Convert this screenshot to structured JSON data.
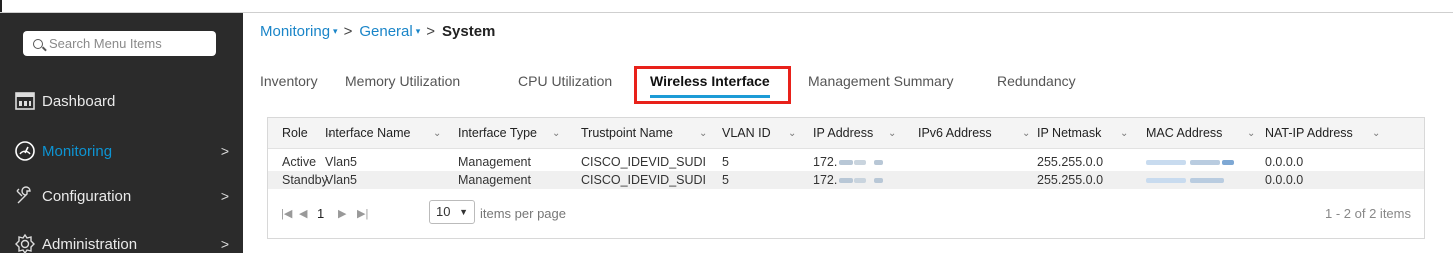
{
  "sidebar": {
    "search": {
      "placeholder": "Search Menu Items"
    },
    "items": [
      {
        "label": "Dashboard",
        "icon": "dashboard-icon"
      },
      {
        "label": "Monitoring",
        "icon": "gauge-icon",
        "chevron": ">"
      },
      {
        "label": "Configuration",
        "icon": "wrench-icon",
        "chevron": ">"
      },
      {
        "label": "Administration",
        "icon": "gear-icon",
        "chevron": ">"
      }
    ],
    "colors": {
      "background": "#2b2b2b",
      "active": "#0d94d3"
    }
  },
  "breadcrumb": {
    "items": [
      "Monitoring",
      "General",
      "System"
    ],
    "caret": "▾",
    "separator": ">"
  },
  "tabs": [
    "Inventory",
    "Memory Utilization",
    "CPU Utilization",
    "Wireless Interface",
    "Management Summary",
    "Redundancy"
  ],
  "active_tab": "Wireless Interface",
  "highlight_color": "#e8211a",
  "table": {
    "columns": [
      "Role",
      "Interface Name",
      "Interface Type",
      "Trustpoint Name",
      "VLAN ID",
      "IP Address",
      "IPv6 Address",
      "IP Netmask",
      "MAC Address",
      "NAT-IP Address"
    ],
    "rows": [
      [
        "Active",
        "Vlan5",
        "Management",
        "CISCO_IDEVID_SUDI",
        "5",
        "172.",
        "",
        "255.255.0.0",
        "",
        "0.0.0.0"
      ],
      [
        "Standby",
        "Vlan5",
        "Management",
        "CISCO_IDEVID_SUDI",
        "5",
        "172.",
        "",
        "255.255.0.0",
        "",
        "0.0.0.0"
      ]
    ],
    "sort_caret": "⌄"
  },
  "pager": {
    "first": "|◀",
    "prev": "◀",
    "page": "1",
    "next": "▶",
    "last": "▶|",
    "page_size": "10",
    "page_size_label": "items per page",
    "count": "1 - 2 of 2 items"
  }
}
